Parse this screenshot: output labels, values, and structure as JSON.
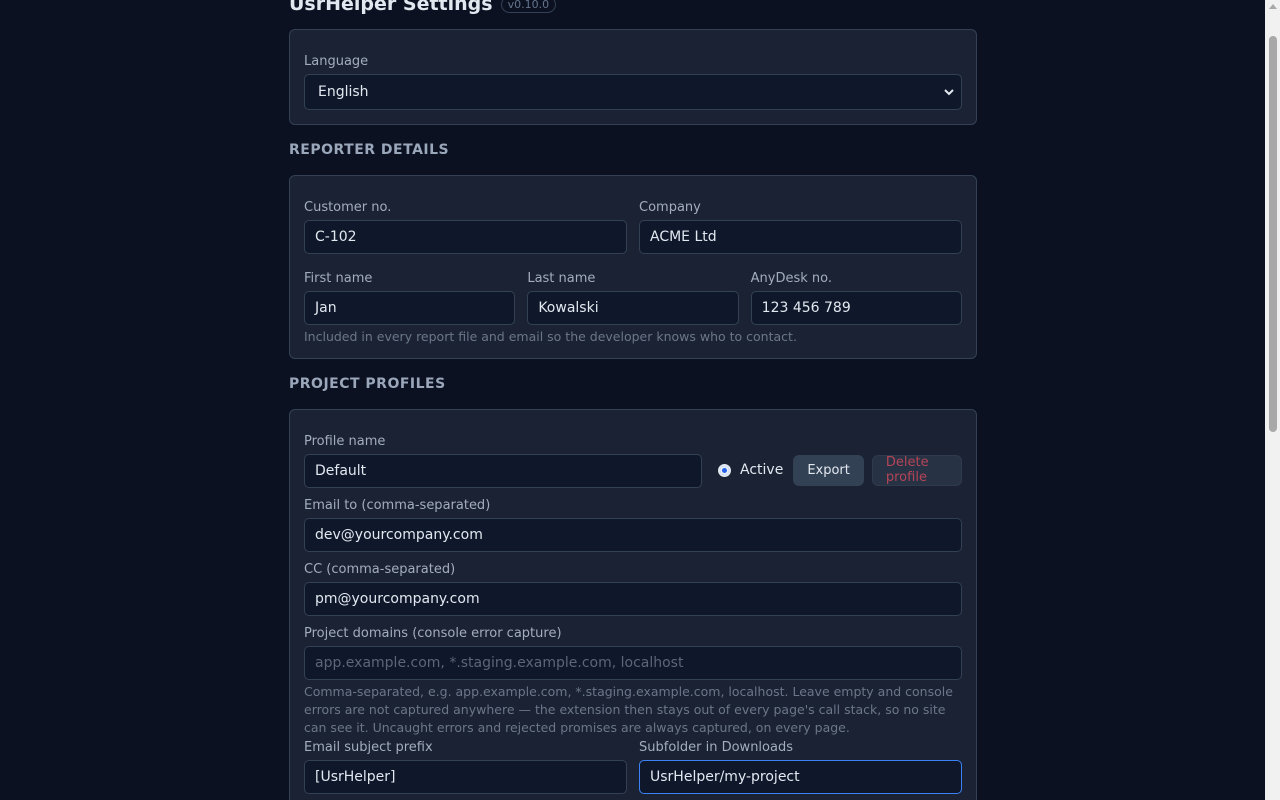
{
  "header": {
    "title": "UsrHelper Settings",
    "version": "v0.10.0"
  },
  "language": {
    "label": "Language",
    "value": "English"
  },
  "reporter": {
    "section_title": "REPORTER DETAILS",
    "customer_no": {
      "label": "Customer no.",
      "value": "C-102"
    },
    "company": {
      "label": "Company",
      "value": "ACME Ltd"
    },
    "first_name": {
      "label": "First name",
      "value": "Jan"
    },
    "last_name": {
      "label": "Last name",
      "value": "Kowalski"
    },
    "anydesk": {
      "label": "AnyDesk no.",
      "value": "123 456 789"
    },
    "hint": "Included in every report file and email so the developer knows who to contact."
  },
  "profiles": {
    "section_title": "PROJECT PROFILES",
    "profile_name": {
      "label": "Profile name",
      "value": "Default"
    },
    "active_label": "Active",
    "export_label": "Export",
    "delete_label": "Delete profile",
    "email_to": {
      "label": "Email to (comma-separated)",
      "value": "dev@yourcompany.com"
    },
    "cc": {
      "label": "CC (comma-separated)",
      "value": "pm@yourcompany.com"
    },
    "domains": {
      "label": "Project domains (console error capture)",
      "placeholder": "app.example.com, *.staging.example.com, localhost",
      "hint": "Comma-separated, e.g. app.example.com, *.staging.example.com, localhost. Leave empty and console errors are not captured anywhere — the extension then stays out of every page's call stack, so no site can see it. Uncaught errors and rejected promises are always captured, on every page."
    },
    "subject_prefix": {
      "label": "Email subject prefix",
      "value": "[UsrHelper]"
    },
    "subfolder": {
      "label": "Subfolder in Downloads",
      "value": "UsrHelper/my-project"
    }
  },
  "colors": {
    "background": "#0b1120",
    "card": "#1a2233",
    "accent": "#3b82f6",
    "danger": "#b34556"
  }
}
